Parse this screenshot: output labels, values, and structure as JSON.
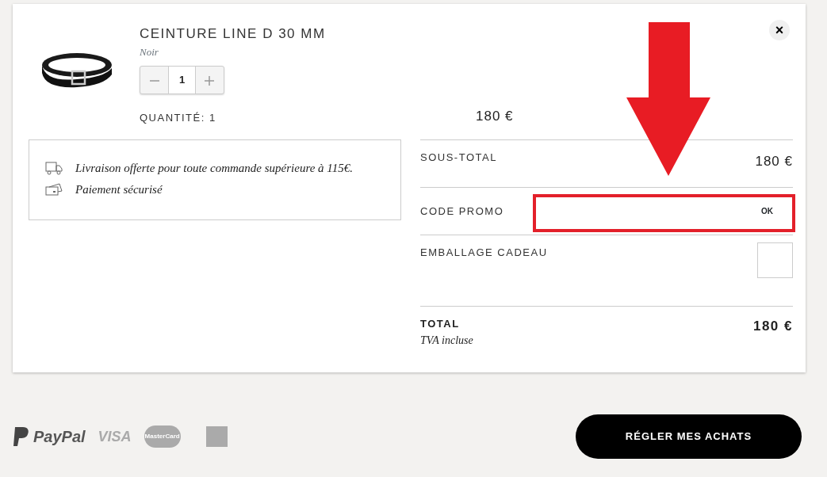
{
  "cart_item": {
    "name": "CEINTURE LINE D 30 MM",
    "variant": "Noir",
    "quantity": "1",
    "quantity_label": "QUANTITÉ: 1",
    "price": "180 €",
    "remove": "×"
  },
  "info": [
    {
      "kind": "delivery",
      "text": "Livraison offerte pour toute commande supérieure à 115€."
    },
    {
      "kind": "payment",
      "text": "Paiement sécurisé"
    }
  ],
  "summary": {
    "subtotal": {
      "label": "SOUS-TOTAL",
      "value": "180 €"
    },
    "promo": {
      "label": "CODE PROMO",
      "button": "OK"
    },
    "gift_wrap": {
      "label": "EMBALLAGE CADEAU",
      "checked": false
    },
    "total": {
      "label": "TOTAL",
      "value": "180 €",
      "note": "TVA incluse"
    }
  },
  "payment_logos": [
    {
      "kind": "paypal",
      "text": "PayPal"
    },
    {
      "kind": "visa",
      "text": "VISA"
    },
    {
      "kind": "mastercard",
      "text": "MasterCard"
    },
    {
      "kind": "amex"
    }
  ],
  "checkout_button": "RÉGLER MES ACHATS"
}
